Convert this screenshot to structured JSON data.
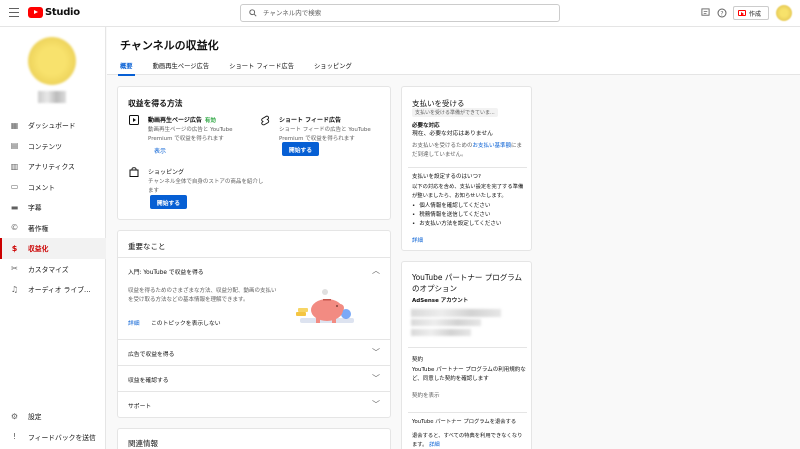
{
  "app": {
    "logo_text": "Studio",
    "search_placeholder": "チャンネル内で検索",
    "create_label": "作成"
  },
  "sidebar": {
    "items": [
      {
        "label": "ダッシュボード",
        "icon": "dashboard-icon",
        "glyph": "▦"
      },
      {
        "label": "コンテンツ",
        "icon": "content-icon",
        "glyph": "▤"
      },
      {
        "label": "アナリティクス",
        "icon": "analytics-icon",
        "glyph": "▥"
      },
      {
        "label": "コメント",
        "icon": "comment-icon",
        "glyph": "▭"
      },
      {
        "label": "字幕",
        "icon": "subtitles-icon",
        "glyph": "▬"
      },
      {
        "label": "著作権",
        "icon": "copyright-icon",
        "glyph": "©"
      },
      {
        "label": "収益化",
        "icon": "monetization-icon",
        "glyph": "$",
        "active": true
      },
      {
        "label": "カスタマイズ",
        "icon": "customize-icon",
        "glyph": "✂"
      },
      {
        "label": "オーディオ ライブ...",
        "icon": "audio-library-icon",
        "glyph": "♫"
      }
    ],
    "bottom": [
      {
        "label": "設定",
        "icon": "settings-icon",
        "glyph": "⚙"
      },
      {
        "label": "フィードバックを送信",
        "icon": "feedback-icon",
        "glyph": "!"
      }
    ]
  },
  "header": {
    "title": "チャンネルの収益化",
    "tabs": [
      "概要",
      "動画再生ページ広告",
      "ショート フィード広告",
      "ショッピング"
    ]
  },
  "earn": {
    "title": "収益を得る方法",
    "video_ads": {
      "name": "動画再生ページ広告",
      "status": "有効",
      "desc": "動画再生ページの広告と YouTube Premium で収益を得られます",
      "link": "表示"
    },
    "shorts": {
      "name": "ショート フィード広告",
      "desc": "ショート フィードの広告と YouTube Premium で収益を得られます",
      "button": "開始する"
    },
    "shopping": {
      "name": "ショッピング",
      "desc": "チャンネル全体で自身のストアの商品を紹介します",
      "button": "開始する"
    }
  },
  "important": {
    "title": "重要なこと",
    "intro_title": "入門: YouTube で収益を得る",
    "intro_desc": "収益を得るためのさまざまな方法、収益分配、動画の支払いを受け取る方法などの基本情報を理解できます。",
    "link_details": "詳細",
    "link_hide": "このトピックを表示しない",
    "rows": [
      "広告で収益を得る",
      "収益を確認する",
      "サポート"
    ]
  },
  "related": {
    "title": "関連情報"
  },
  "payment": {
    "title": "支払いを受ける",
    "badge": "支払いを受ける準備ができていま...",
    "required_label": "必要な対応",
    "required_value": "現在、必要な対応はありません",
    "info_line1": "お支払いを受けるための",
    "info_link": "お支払い基準額",
    "info_line2": "に",
    "info_line3": "まだ到達していません。",
    "how_title": "支払いを設定するのはいつ?",
    "how_desc": "以下の対応を含め、支払い設定を完了する準備が整いましたら、お知らせいたします。",
    "bullets": [
      "個人情報を確認してください",
      "税務情報を送信してください",
      "お支払い方法を設定してください"
    ],
    "link": "詳細"
  },
  "partner": {
    "title": "YouTube パートナー プログラムのオプション",
    "adsense_label": "AdSense アカウント",
    "contract_label": "契約",
    "contract_desc": "YouTube パートナー プログラムの利用規約など、同意した契約を確認します",
    "contract_link": "契約を表示",
    "leave_title": "YouTube パートナー プログラムを退会する",
    "leave_desc": "退会すると、すべての特典を利用できなくなります。",
    "leave_link": "詳細"
  },
  "colors": {
    "accent_blue": "#065fd4",
    "youtube_red": "#ff0000",
    "active_red": "#cc0000",
    "enabled_green": "#2ba640"
  }
}
